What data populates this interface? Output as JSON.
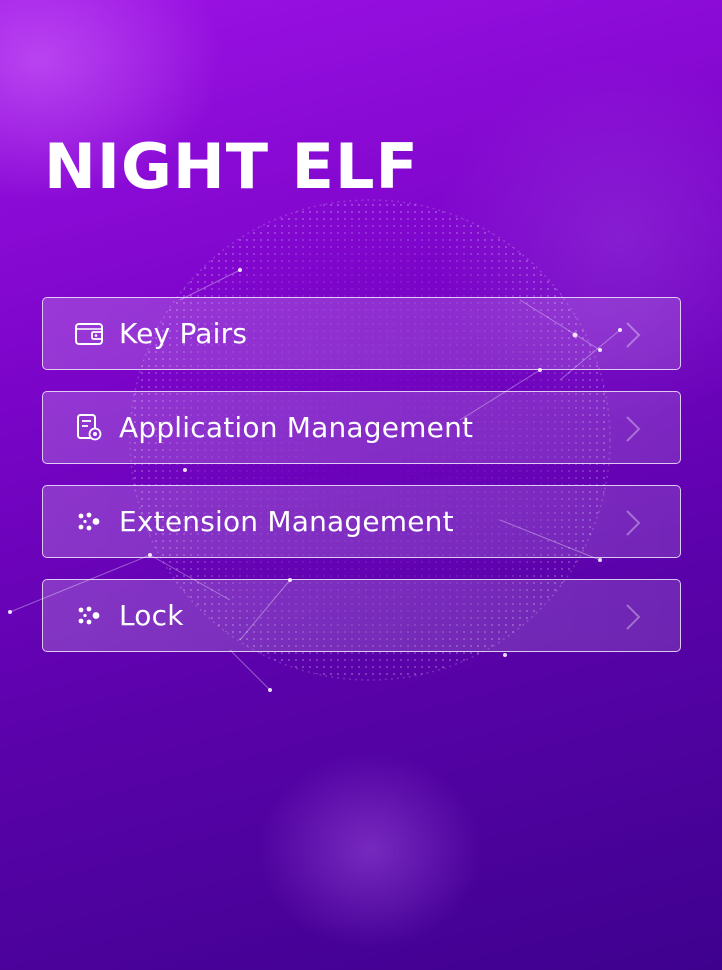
{
  "app": {
    "title": "NIGHT ELF"
  },
  "menu": {
    "items": [
      {
        "label": "Key Pairs",
        "icon": "wallet-icon"
      },
      {
        "label": "Application Management",
        "icon": "document-settings-icon"
      },
      {
        "label": "Extension Management",
        "icon": "nodes-icon"
      },
      {
        "label": "Lock",
        "icon": "nodes-icon"
      }
    ]
  },
  "colors": {
    "background_top": "#9c12e4",
    "background_bottom": "#3e018e",
    "text": "#ffffff"
  }
}
